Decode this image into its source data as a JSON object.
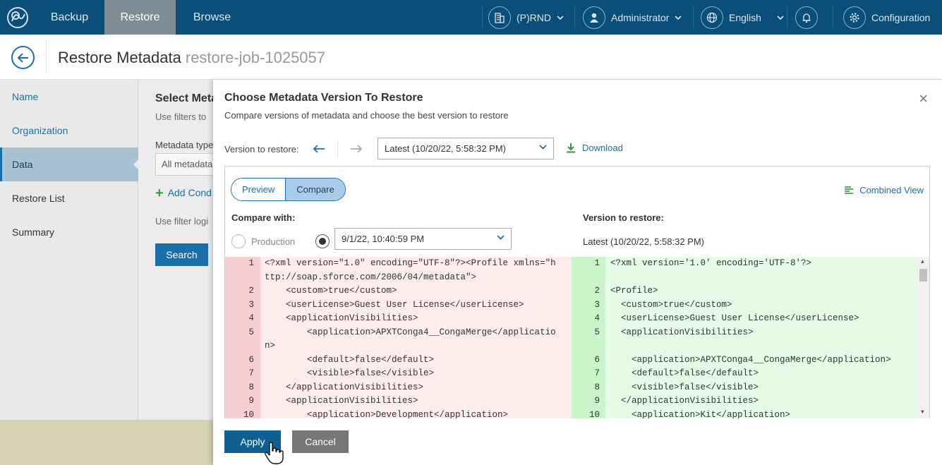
{
  "nav": {
    "tabs": [
      "Backup",
      "Restore",
      "Browse"
    ],
    "org": "(P)RND",
    "user": "Administrator",
    "language": "English",
    "config": "Configuration"
  },
  "header": {
    "title": "Restore Metadata",
    "subtitle": "restore-job-1025057"
  },
  "sidebar": {
    "items": [
      "Name",
      "Organization",
      "Data",
      "Restore List",
      "Summary"
    ]
  },
  "background": {
    "title": "Select Meta",
    "desc": "Use filters to",
    "metadata_type_label": "Metadata type",
    "metadata_type_value": "All metadata",
    "add_condition": "Add Cond",
    "filter_logic": "Use filter logi",
    "search": "Search"
  },
  "dialog": {
    "title": "Choose Metadata Version To Restore",
    "subtitle": "Compare versions of metadata and choose the best version to restore",
    "version_label": "Version to restore:",
    "version_value": "Latest (10/20/22, 5:58:32 PM)",
    "download": "Download",
    "tabs": {
      "preview": "Preview",
      "compare": "Compare"
    },
    "combined_view": "Combined View",
    "compare_with_label": "Compare with:",
    "production": "Production",
    "compare_value": "9/1/22, 10:40:59 PM",
    "version_to_restore_label": "Version to restore:",
    "version_to_restore_value": "Latest (10/20/22, 5:58:32 PM)",
    "apply": "Apply",
    "cancel": "Cancel"
  },
  "diff": {
    "left_nums": [
      "1",
      "",
      "2",
      "3",
      "4",
      "5",
      "",
      "6",
      "7",
      "8",
      "9",
      "10"
    ],
    "left_lines": [
      "<?xml version=\"1.0\" encoding=\"UTF-8\"?><Profile xmlns=\"h",
      "ttp://soap.sforce.com/2006/04/metadata\">",
      "    <custom>true</custom>",
      "    <userLicense>Guest User License</userLicense>",
      "    <applicationVisibilities>",
      "        <application>APXTConga4__CongaMerge</applicatio",
      "n>",
      "        <default>false</default>",
      "        <visible>false</visible>",
      "    </applicationVisibilities>",
      "    <applicationVisibilities>",
      "        <application>Development</application>"
    ],
    "right_nums": [
      "1",
      "",
      "2",
      "3",
      "4",
      "5",
      "",
      "6",
      "7",
      "8",
      "9",
      "10"
    ],
    "right_lines": [
      "<?xml version='1.0' encoding='UTF-8'?>",
      "",
      "<Profile>",
      "  <custom>true</custom>",
      "  <userLicense>Guest User License</userLicense>",
      "  <applicationVisibilities>",
      "",
      "    <application>APXTConga4__CongaMerge</application>",
      "    <default>false</default>",
      "    <visible>false</visible>",
      "  </applicationVisibilities>",
      "    <application>Kit</application>"
    ]
  },
  "colors": {
    "nav_bg": "#0a4f79",
    "accent": "#1b6fa8",
    "left_diff_bg": "#fdecec",
    "left_gutter_bg": "#f7cfd1",
    "right_diff_bg": "#e6fbe6",
    "right_gutter_bg": "#c9f5c9",
    "apply_bg": "#0f5f93",
    "cancel_bg": "#777777"
  }
}
